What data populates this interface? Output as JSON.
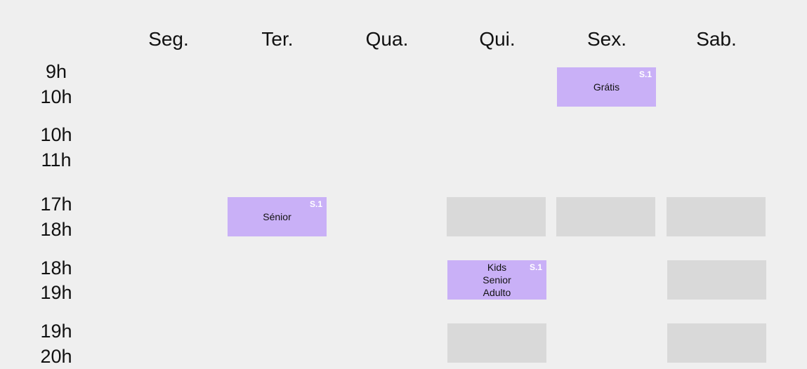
{
  "days": [
    "Seg.",
    "Ter.",
    "Qua.",
    "Qui.",
    "Sex.",
    "Sab."
  ],
  "slots": [
    {
      "start": "9h",
      "end": "10h"
    },
    {
      "start": "10h",
      "end": "11h"
    },
    {
      "start": "17h",
      "end": "18h"
    },
    {
      "start": "18h",
      "end": "19h"
    },
    {
      "start": "19h",
      "end": "20h"
    }
  ],
  "events": {
    "sex_9": {
      "label": "Grátis",
      "badge": "S.1"
    },
    "ter_17": {
      "label": "Sénior",
      "badge": "S.1"
    },
    "qui_18": {
      "label": "Kids\nSenior\nAdulto",
      "badge": "S.1"
    }
  }
}
